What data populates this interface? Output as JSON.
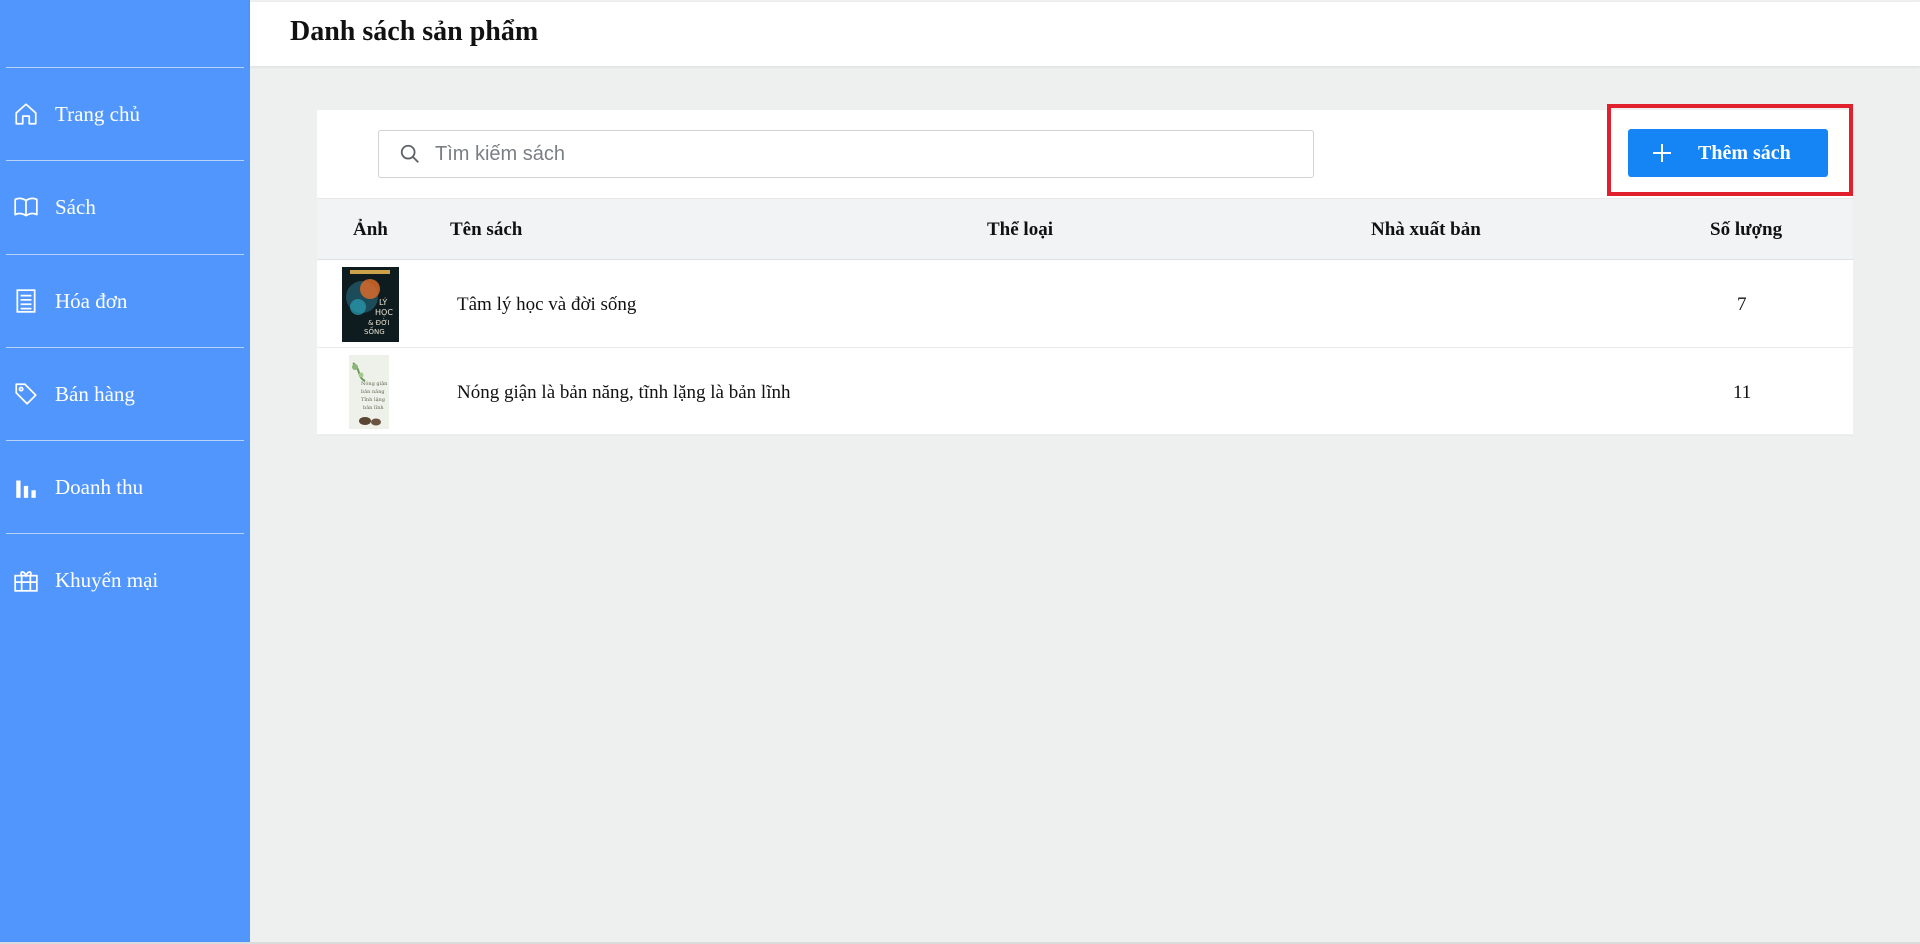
{
  "sidebar": {
    "items": [
      {
        "label": "Trang chủ",
        "icon": "home-icon"
      },
      {
        "label": "Sách",
        "icon": "book-icon"
      },
      {
        "label": "Hóa đơn",
        "icon": "receipt-icon"
      },
      {
        "label": "Bán hàng",
        "icon": "tag-icon"
      },
      {
        "label": "Doanh thu",
        "icon": "bar-chart-icon"
      },
      {
        "label": "Khuyến mại",
        "icon": "gift-icon"
      }
    ]
  },
  "header": {
    "title": "Danh sách sản phẩm"
  },
  "toolbar": {
    "search_placeholder": "Tìm kiếm sách",
    "add_label": "Thêm sách"
  },
  "table": {
    "headers": {
      "image": "Ảnh",
      "name": "Tên sách",
      "category": "Thể loại",
      "publisher": "Nhà xuất bản",
      "quantity": "Số lượng"
    },
    "rows": [
      {
        "name": "Tâm lý học và đời sống",
        "category": "",
        "publisher": "",
        "quantity": "7",
        "cover_text": "TÂM LÝ HỌC & ĐỜI SỐNG"
      },
      {
        "name": "Nóng giận là bản năng, tĩnh lặng là bản lĩnh",
        "category": "",
        "publisher": "",
        "quantity": "11",
        "cover_text": "Nóng giận là bản năng Tĩnh lặng là bản lĩnh"
      }
    ]
  },
  "colors": {
    "sidebar": "#5196fc",
    "accent": "#1584f5",
    "highlight": "#e0202d"
  }
}
